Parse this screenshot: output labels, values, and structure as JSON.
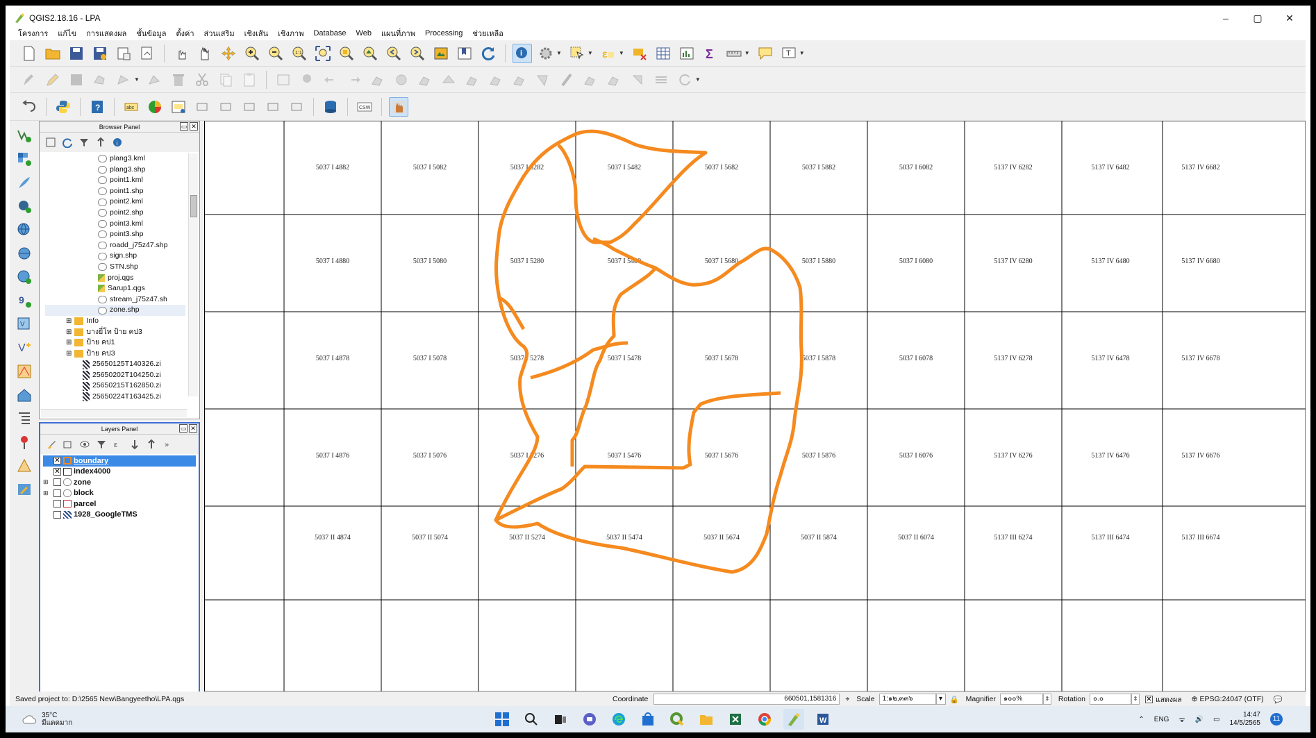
{
  "window": {
    "title": "QGIS2.18.16 - LPA",
    "controls": [
      "–",
      "▢",
      "✕"
    ]
  },
  "menu": [
    "โครงการ",
    "แก้ไข",
    "การแสดงผล",
    "ชั้นข้อมูล",
    "ตั้งค่า",
    "ส่วนเสริม",
    "เชิงเส้น",
    "เชิงภาพ",
    "Database",
    "Web",
    "แผนที่ภาพ",
    "Processing",
    "ช่วยเหลือ"
  ],
  "browser_panel": {
    "title": "Browser Panel",
    "items": [
      {
        "label": "plang3.kml",
        "kind": "file"
      },
      {
        "label": "plang3.shp",
        "kind": "file"
      },
      {
        "label": "point1.kml",
        "kind": "file"
      },
      {
        "label": "point1.shp",
        "kind": "file"
      },
      {
        "label": "point2.kml",
        "kind": "file"
      },
      {
        "label": "point2.shp",
        "kind": "file"
      },
      {
        "label": "point3.kml",
        "kind": "file"
      },
      {
        "label": "point3.shp",
        "kind": "file"
      },
      {
        "label": "roadd_j75z47.shp",
        "kind": "file"
      },
      {
        "label": "sign.shp",
        "kind": "file"
      },
      {
        "label": "STN.shp",
        "kind": "file"
      },
      {
        "label": "proj.qgs",
        "kind": "qgs"
      },
      {
        "label": "Sarup1.qgs",
        "kind": "qgs"
      },
      {
        "label": "stream_j75z47.sh",
        "kind": "file"
      },
      {
        "label": "zone.shp",
        "kind": "file-selected"
      },
      {
        "label": "Info",
        "kind": "folder"
      },
      {
        "label": "บางยี่โท ป้าย คป3",
        "kind": "folder"
      },
      {
        "label": "ป้าย คป1",
        "kind": "folder"
      },
      {
        "label": "ป้าย คป3",
        "kind": "folder"
      },
      {
        "label": "25650125T140326.zi",
        "kind": "zip"
      },
      {
        "label": "25650202T104250.zi",
        "kind": "zip"
      },
      {
        "label": "25650215T162850.zi",
        "kind": "zip"
      },
      {
        "label": "25650224T163425.zi",
        "kind": "zip"
      }
    ]
  },
  "layers_panel": {
    "title": "Layers Panel",
    "layers": [
      {
        "name": "boundary",
        "checked": true,
        "selected": true,
        "expand": false
      },
      {
        "name": "index4000",
        "checked": true,
        "selected": false,
        "expand": false
      },
      {
        "name": "zone",
        "checked": false,
        "selected": false,
        "expand": true
      },
      {
        "name": "block",
        "checked": false,
        "selected": false,
        "expand": true
      },
      {
        "name": "parcel",
        "checked": false,
        "selected": false,
        "expand": false
      },
      {
        "name": "1928_GoogleTMS",
        "checked": false,
        "selected": false,
        "expand": false
      }
    ]
  },
  "map": {
    "boundary_color": "#f58a1f",
    "grid_labels": [
      [
        "5037 I 4882",
        "5037 I 5082",
        "5037 I 5282",
        "5037 I 5482",
        "5037 I 5682",
        "5037 I 5882",
        "5037 I 6082",
        "5137 IV 6282",
        "5137 IV 6482",
        "5137 IV 6682"
      ],
      [
        "5037 I 4880",
        "5037 I 5080",
        "5037 I 5280",
        "5037 I 5480",
        "5037 I 5680",
        "5037 I 5880",
        "5037 I 6080",
        "5137 IV 6280",
        "5137 IV 6480",
        "5137 IV 6680"
      ],
      [
        "5037 I 4878",
        "5037 I 5078",
        "5037 I 5278",
        "5037 I 5478",
        "5037 I 5678",
        "5037 I 5878",
        "5037 I 6078",
        "5137 IV 6278",
        "5137 IV 6478",
        "5137 IV 6678"
      ],
      [
        "5037 I 4876",
        "5037 I 5076",
        "5037 I 5276",
        "5037 I 5476",
        "5037 I 5676",
        "5037 I 5876",
        "5037 I 6076",
        "5137 IV 6276",
        "5137 IV 6476",
        "5137 IV 6676"
      ],
      [
        "5037 II 4874",
        "5037 II 5074",
        "5037 II 5274",
        "5037 II 5474",
        "5037 II 5674",
        "5037 II 5874",
        "5037 II 6074",
        "5137 III 6274",
        "5137 III 6474",
        "5137 III 6674"
      ]
    ]
  },
  "status": {
    "message": "Saved project to: D:\\2565 New\\Bangyeetho\\LPA.qgs",
    "coordinate_label": "Coordinate",
    "coordinate_value": "660501,1581316",
    "scale_label": "Scale",
    "scale_value": "1:๑๒,๓๓๖",
    "magnifier_label": "Magnifier",
    "magnifier_value": "๑๐๐%",
    "rotation_label": "Rotation",
    "rotation_value": "๐.๐",
    "render_label": "แสดงผล",
    "crs": "EPSG:24047 (OTF)"
  },
  "taskbar": {
    "temperature": "35°C",
    "weather_text": "มีแดดมาก",
    "lang": "ENG",
    "time": "14:47",
    "date": "14/5/2565",
    "notifications": "11"
  }
}
